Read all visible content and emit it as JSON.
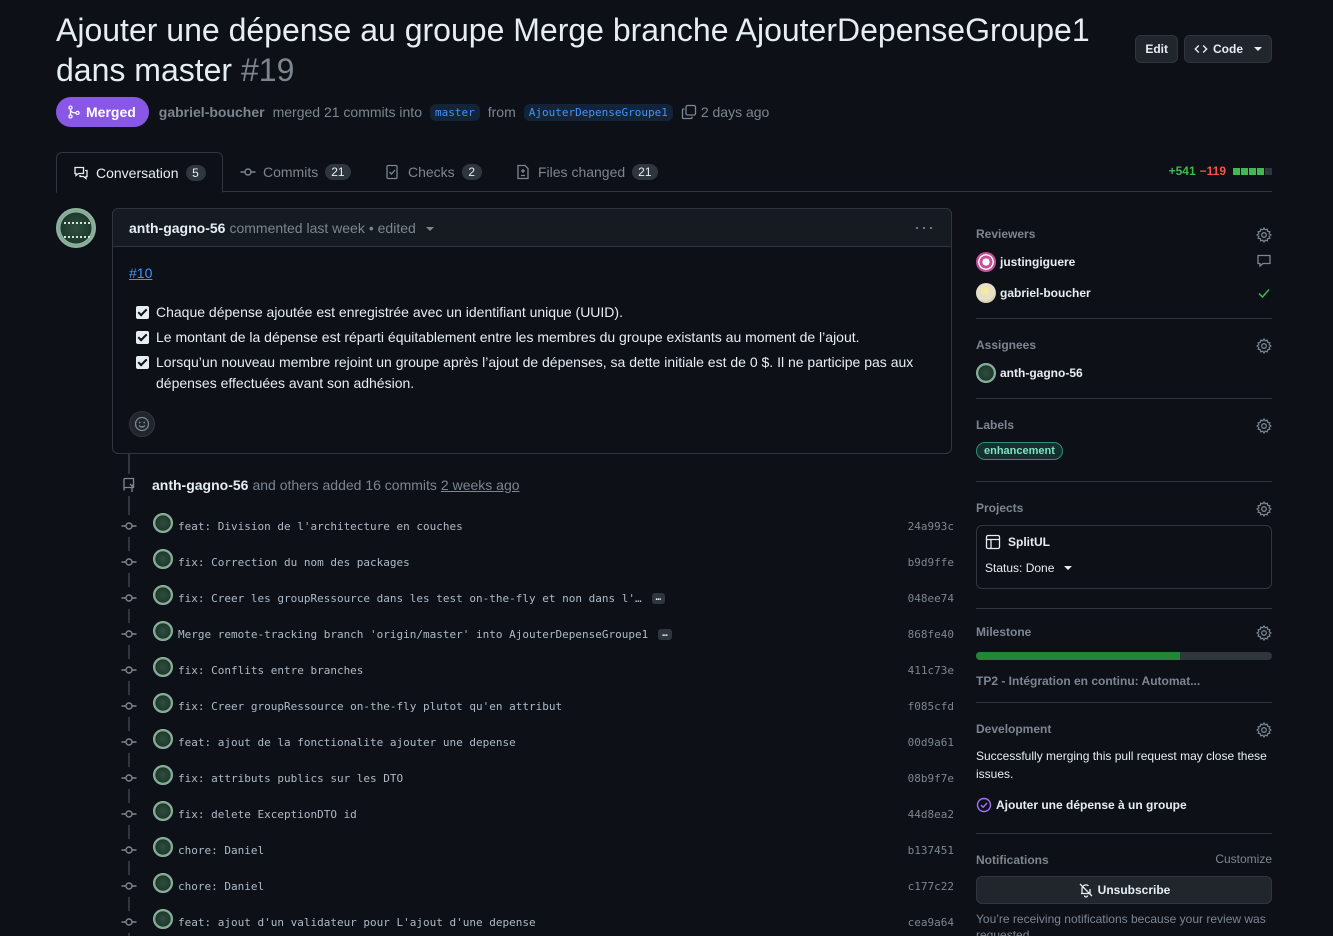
{
  "header": {
    "title": "Ajouter une dépense au groupe Merge branche AjouterDepenseGroupe1 dans master",
    "number": "#19",
    "edit_label": "Edit",
    "code_label": "Code"
  },
  "meta": {
    "state": "Merged",
    "author": "gabriel-boucher",
    "action": "merged 21 commits into",
    "base_branch": "master",
    "from_word": "from",
    "head_branch": "AjouterDepenseGroupe1",
    "time": "2 days ago"
  },
  "tabs": [
    {
      "label": "Conversation",
      "count": "5"
    },
    {
      "label": "Commits",
      "count": "21"
    },
    {
      "label": "Checks",
      "count": "2"
    },
    {
      "label": "Files changed",
      "count": "21"
    }
  ],
  "diffstat": {
    "additions": "+541",
    "deletions": "−119",
    "blocks": [
      "#3fb950",
      "#3fb950",
      "#3fb950",
      "#3fb950",
      "#30363d"
    ]
  },
  "comment": {
    "author": "anth-gagno-56",
    "action": "commented last week",
    "edited": "• edited",
    "issue_ref": "#10",
    "tasks": [
      "Chaque dépense ajoutée est enregistrée avec un identifiant unique (UUID).",
      "Le montant de la dépense est réparti équitablement entre les membres du groupe existants au moment de l’ajout.",
      "Lorsqu’un nouveau membre rejoint un groupe après l’ajout de dépenses, sa dette initiale est de 0 $. Il ne participe pas aux dépenses effectuées avant son adhésion."
    ]
  },
  "push_event": {
    "author": "anth-gagno-56",
    "text": "and others added 16 commits",
    "time": "2 weeks ago"
  },
  "commits": [
    {
      "msg": "feat: Division de l'architecture en couches",
      "sha": "24a993c",
      "more": ""
    },
    {
      "msg": "fix: Correction du nom des packages",
      "sha": "b9d9ffe",
      "more": ""
    },
    {
      "msg": "fix: Creer les groupRessource dans les test on-the-fly et non dans l'…",
      "sha": "048ee74",
      "more": "…"
    },
    {
      "msg": "Merge remote-tracking branch 'origin/master' into AjouterDepenseGroupe1",
      "sha": "868fe40",
      "more": "…"
    },
    {
      "msg": "fix: Conflits entre branches",
      "sha": "411c73e",
      "more": ""
    },
    {
      "msg": "fix: Creer groupRessource on-the-fly plutot qu'en attribut",
      "sha": "f085cfd",
      "more": ""
    },
    {
      "msg": "feat: ajout de la fonctionalite ajouter une depense",
      "sha": "00d9a61",
      "more": ""
    },
    {
      "msg": "fix: attributs publics sur les DTO",
      "sha": "08b9f7e",
      "more": ""
    },
    {
      "msg": "fix: delete ExceptionDTO id",
      "sha": "44d8ea2",
      "more": ""
    },
    {
      "msg": "chore: Daniel",
      "sha": "b137451",
      "more": ""
    },
    {
      "msg": "chore: Daniel",
      "sha": "c177c22",
      "more": ""
    },
    {
      "msg": "feat: ajout d'un validateur pour L'ajout d'une depense",
      "sha": "cea9a64",
      "more": ""
    }
  ],
  "sidebar": {
    "reviewers_title": "Reviewers",
    "reviewers": [
      {
        "name": "justingiguere",
        "status_icon": "comment-icon"
      },
      {
        "name": "gabriel-boucher",
        "status_icon": "check-icon"
      }
    ],
    "assignees_title": "Assignees",
    "assignee": "anth-gagno-56",
    "labels_title": "Labels",
    "label": "enhancement",
    "projects_title": "Projects",
    "project_name": "SplitUL",
    "project_status": "Status: Done",
    "milestone_title": "Milestone",
    "milestone_progress": 0.69,
    "milestone_name": "TP2 - Intégration en continu: Automat...",
    "development_title": "Development",
    "development_text": "Successfully merging this pull request may close these issues.",
    "development_issue": "Ajouter une dépense à un groupe",
    "notifications_title": "Notifications",
    "customize_label": "Customize",
    "unsubscribe_label": "Unsubscribe",
    "notifications_text": "You’re receiving notifications because your review was requested."
  },
  "colors": {
    "merged": "#8957e5",
    "link": "#4493f8",
    "add": "#3fb950",
    "del": "#f85149"
  }
}
